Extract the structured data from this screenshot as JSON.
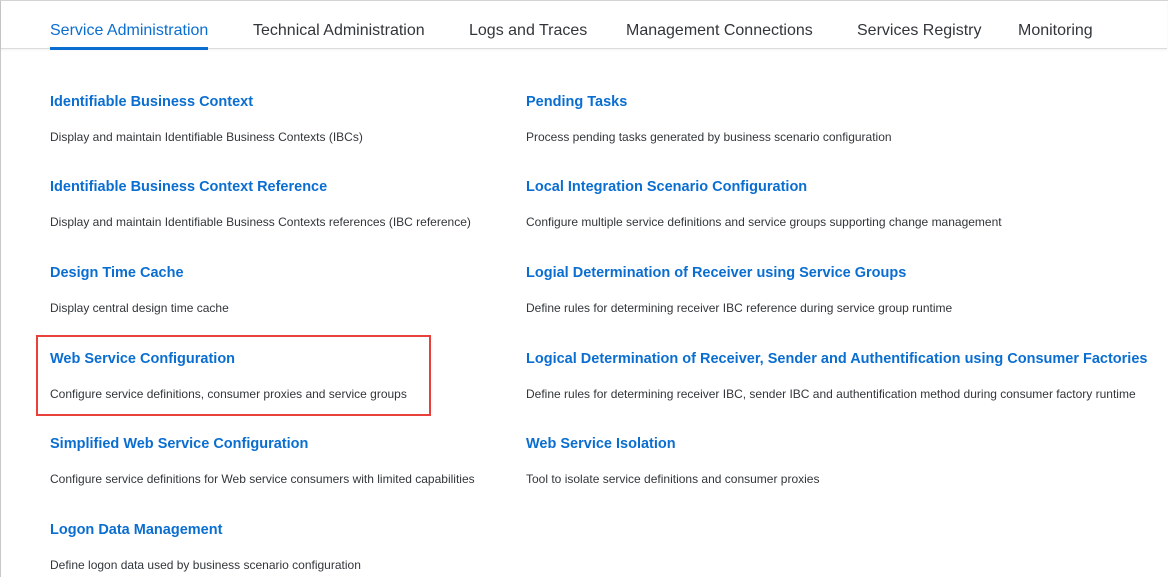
{
  "tabs": [
    {
      "label": "Service Administration",
      "active": true
    },
    {
      "label": "Technical Administration",
      "active": false
    },
    {
      "label": "Logs and Traces",
      "active": false
    },
    {
      "label": "Management Connections",
      "active": false
    },
    {
      "label": "Services Registry",
      "active": false
    },
    {
      "label": "Monitoring",
      "active": false
    }
  ],
  "left_tiles": [
    {
      "title": "Identifiable Business Context",
      "description": "Display and maintain Identifiable Business Contexts (IBCs)"
    },
    {
      "title": "Identifiable Business Context Reference",
      "description": "Display and maintain Identifiable Business Contexts references (IBC reference)"
    },
    {
      "title": "Design Time Cache",
      "description": "Display central design time cache"
    },
    {
      "title": "Web Service Configuration",
      "description": "Configure service definitions, consumer proxies and service groups"
    },
    {
      "title": "Simplified Web Service Configuration",
      "description": "Configure service definitions for Web service consumers with limited capabilities"
    },
    {
      "title": "Logon Data Management",
      "description": "Define logon data used by business scenario configuration"
    }
  ],
  "right_tiles": [
    {
      "title": "Pending Tasks",
      "description": "Process pending tasks generated by business scenario configuration"
    },
    {
      "title": "Local Integration Scenario Configuration",
      "description": "Configure multiple service definitions and service groups supporting change management"
    },
    {
      "title": "Logial Determination of Receiver using Service Groups",
      "description": "Define rules for determining receiver IBC reference during service group runtime"
    },
    {
      "title": "Logical Determination of Receiver, Sender and Authentification using Consumer Factories",
      "description": "Define rules for determining receiver IBC, sender IBC and authentification method during consumer factory runtime"
    },
    {
      "title": "Web Service Isolation",
      "description": "Tool to isolate service definitions and consumer proxies"
    }
  ],
  "highlighted_tile": "Web Service Configuration",
  "colors": {
    "accent": "#0a6ed1",
    "text": "#32363a",
    "highlight_border": "#e8413b"
  }
}
